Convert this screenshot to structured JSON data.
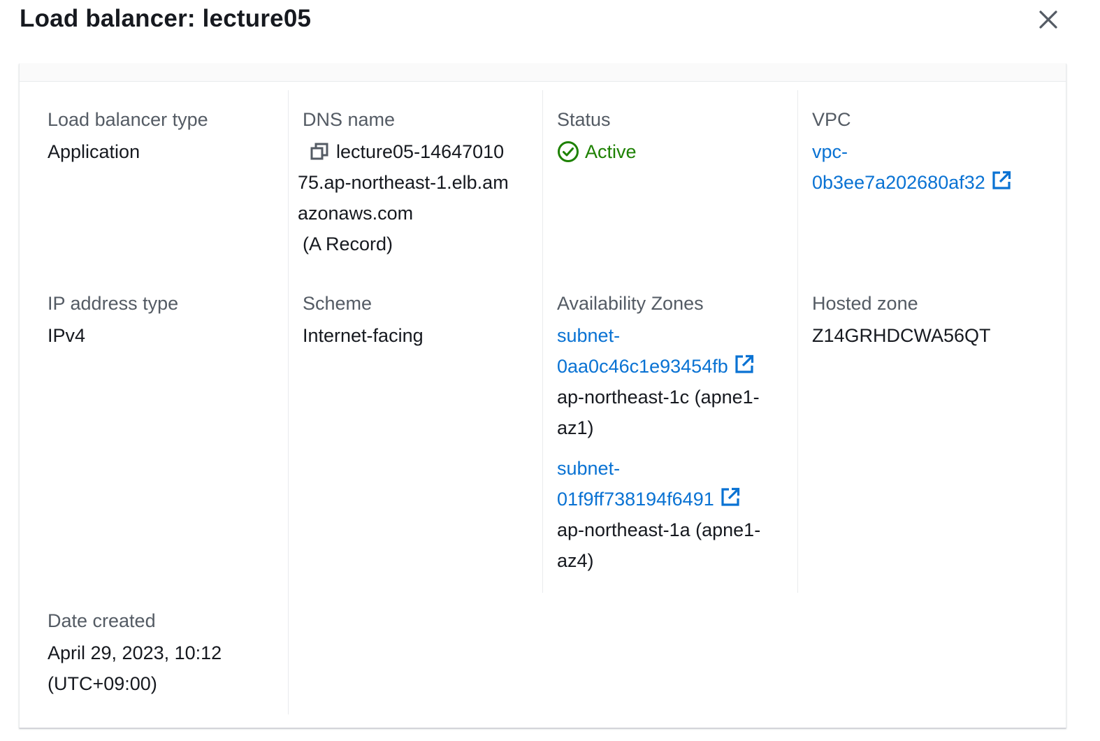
{
  "modal": {
    "title": "Load balancer: lecture05"
  },
  "details": {
    "load_balancer_type": {
      "label": "Load balancer type",
      "value": "Application"
    },
    "dns_name": {
      "label": "DNS name",
      "line1": "lecture05-14647010",
      "line2": "75.ap-northeast-1.elb.am",
      "line3": "azonaws.com",
      "record": "(A Record)"
    },
    "status": {
      "label": "Status",
      "value": "Active"
    },
    "vpc": {
      "label": "VPC",
      "line1": "vpc-",
      "line2": "0b3ee7a202680af32"
    },
    "ip_address_type": {
      "label": "IP address type",
      "value": "IPv4"
    },
    "scheme": {
      "label": "Scheme",
      "value": "Internet-facing"
    },
    "availability_zones": {
      "label": "Availability Zones",
      "items": [
        {
          "link1": "subnet-",
          "link2": "0aa0c46c1e93454fb",
          "zone1": "ap-northeast-1c (apne1-",
          "zone2": "az1)"
        },
        {
          "link1": "subnet-",
          "link2": "01f9ff738194f6491",
          "zone1": "ap-northeast-1a (apne1-",
          "zone2": "az4)"
        }
      ]
    },
    "hosted_zone": {
      "label": "Hosted zone",
      "value": "Z14GRHDCWA56QT"
    },
    "date_created": {
      "label": "Date created",
      "line1": "April 29, 2023, 10:12",
      "line2": "(UTC+09:00)"
    }
  },
  "colors": {
    "link": "#0972d3",
    "success": "#1d8102",
    "label": "#545b64",
    "text": "#16191f",
    "divider": "#e9ebed"
  },
  "icons": {
    "close": "close-icon",
    "copy": "copy-icon",
    "status": "status-positive-icon",
    "external": "external-link-icon"
  }
}
